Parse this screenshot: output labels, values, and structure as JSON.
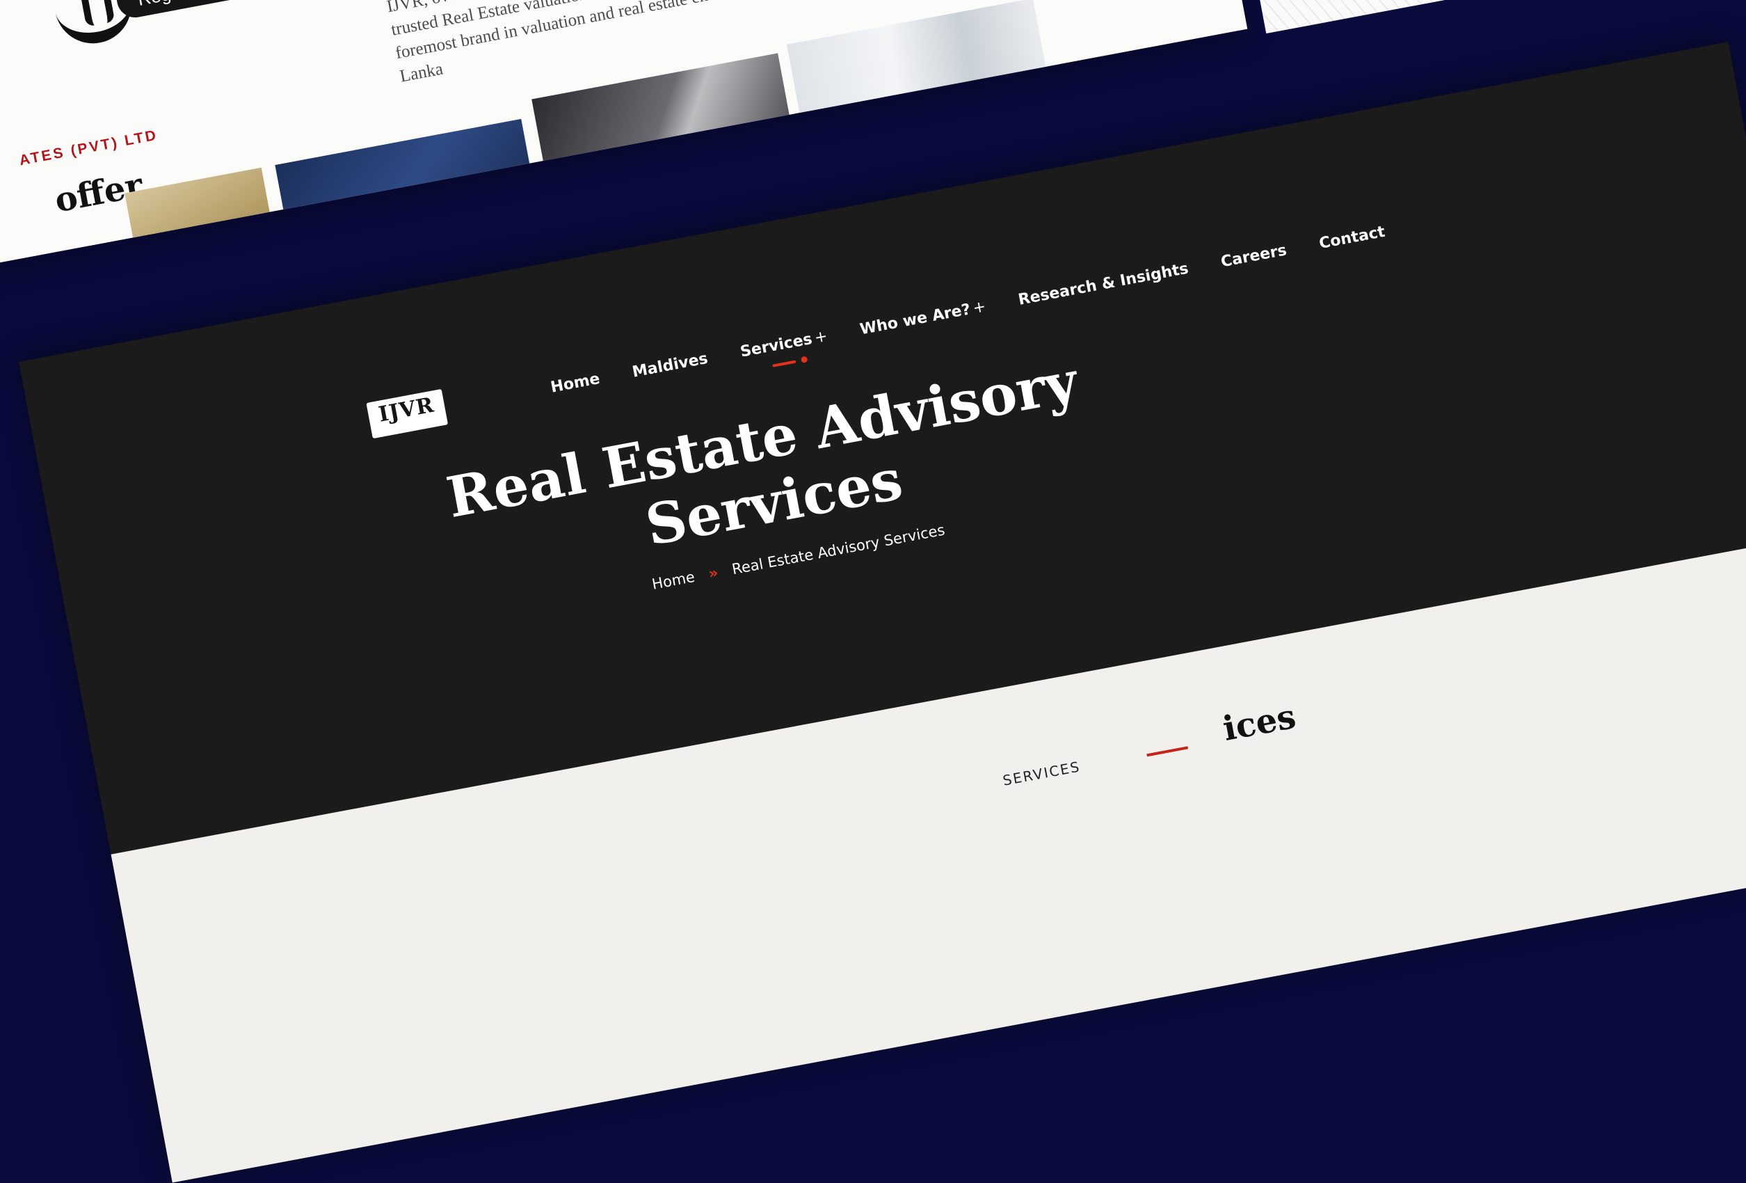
{
  "back_page": {
    "badge_text": "Regulated by",
    "about_text": "IJVR, over the years has evolved to become sought after and trusted Real Estate valuation and Consultancy firms as a foremost brand in valuation and real estate entities in Sri Lanka",
    "company_label": "ATES (PVT) LTD",
    "offer_heading": "offer"
  },
  "front_page": {
    "logo": {
      "text": "IJVR"
    },
    "nav": [
      {
        "label": "Home"
      },
      {
        "label": "Maldives"
      },
      {
        "label": "Services",
        "plus": "+"
      },
      {
        "label": "Who we Are?",
        "plus": "+"
      },
      {
        "label": "Research & Insights"
      },
      {
        "label": "Careers"
      },
      {
        "label": "Contact"
      }
    ],
    "hero_title": "Real Estate Advisory Services",
    "breadcrumb": {
      "home": "Home",
      "separator": "»",
      "current": "Real Estate Advisory Services"
    },
    "section_label": "SERVICES",
    "section_heading": "ices"
  },
  "colors": {
    "accent": "#e2341d",
    "navy_background": "#0a0b3d",
    "hero_background": "#1b1b1b",
    "label_red": "#b5141b"
  }
}
